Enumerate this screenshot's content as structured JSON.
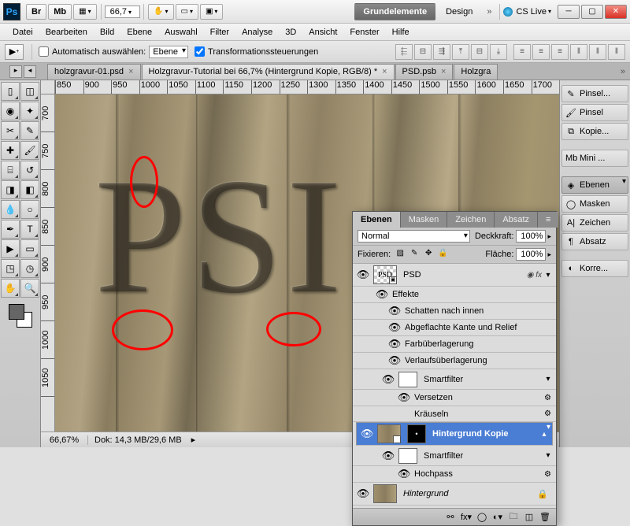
{
  "titlebar": {
    "br_label": "Br",
    "mb_label": "Mb",
    "zoom": "66,7",
    "ws_essentials": "Grundelemente",
    "ws_design": "Design",
    "cslive": "CS Live"
  },
  "menubar": [
    "Datei",
    "Bearbeiten",
    "Bild",
    "Ebene",
    "Auswahl",
    "Filter",
    "Analyse",
    "3D",
    "Ansicht",
    "Fenster",
    "Hilfe"
  ],
  "optionsbar": {
    "auto_select": "Automatisch auswählen:",
    "auto_target": "Ebene",
    "transform_ctrls": "Transformationssteuerungen"
  },
  "tabs": {
    "t1": "holzgravur-01.psd",
    "t2": "Holzgravur-Tutorial bei 66,7% (Hintergrund Kopie, RGB/8) *",
    "t3": "PSD.psb",
    "t4": "Holzgra"
  },
  "ruler_h": [
    "850",
    "900",
    "950",
    "1000",
    "1050",
    "1100",
    "1150",
    "1200",
    "1250",
    "1300",
    "1350",
    "1400",
    "1450",
    "1500",
    "1550",
    "1600",
    "1650",
    "1700"
  ],
  "ruler_v": [
    "700",
    "750",
    "800",
    "850",
    "900",
    "950",
    "1000",
    "1050"
  ],
  "canvas_text": "PSI",
  "statusbar": {
    "zoom": "66,67%",
    "docinfo": "Dok: 14,3 MB/29,6 MB"
  },
  "rail": {
    "pinsel": "Pinsel...",
    "pinsel2": "Pinsel",
    "kopie": "Kopie...",
    "mb": "Mb",
    "mini": "Mini ...",
    "ebenen": "Ebenen",
    "masken": "Masken",
    "zeichen": "Zeichen",
    "absatz": "Absatz",
    "korre": "Korre..."
  },
  "layers_panel": {
    "tabs": {
      "ebenen": "Ebenen",
      "masken": "Masken",
      "zeichen": "Zeichen",
      "absatz": "Absatz"
    },
    "blend_mode": "Normal",
    "opacity_label": "Deckkraft:",
    "opacity_value": "100%",
    "lock_label": "Fixieren:",
    "fill_label": "Fläche:",
    "fill_value": "100%",
    "layers": {
      "psd": "PSD",
      "effekte": "Effekte",
      "schatten_innen": "Schatten nach innen",
      "relief": "Abgeflachte Kante und Relief",
      "farbueberlagerung": "Farbüberlagerung",
      "verlaufsueberlagerung": "Verlaufsüberlagerung",
      "smartfilter": "Smartfilter",
      "versetzen": "Versetzen",
      "kraeuseln": "Kräuseln",
      "hintergrund_kopie": "Hintergrund Kopie",
      "hochpass": "Hochpass",
      "hintergrund": "Hintergrund"
    }
  }
}
